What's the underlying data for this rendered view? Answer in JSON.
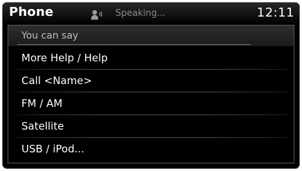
{
  "header": {
    "title": "Phone",
    "status": "Speaking...",
    "time": "12:11",
    "voice_icon": "voice-speaking-icon"
  },
  "list": {
    "section_label": "You can say",
    "items": [
      {
        "label": "More Help / Help"
      },
      {
        "label": "Call <Name>"
      },
      {
        "label": "FM / AM"
      },
      {
        "label": "Satellite"
      },
      {
        "label": "USB / iPod..."
      }
    ]
  },
  "colors": {
    "background": "#000000",
    "text": "#ffffff",
    "status_text": "#8a8a8a",
    "section_text": "#bdbdbd"
  }
}
